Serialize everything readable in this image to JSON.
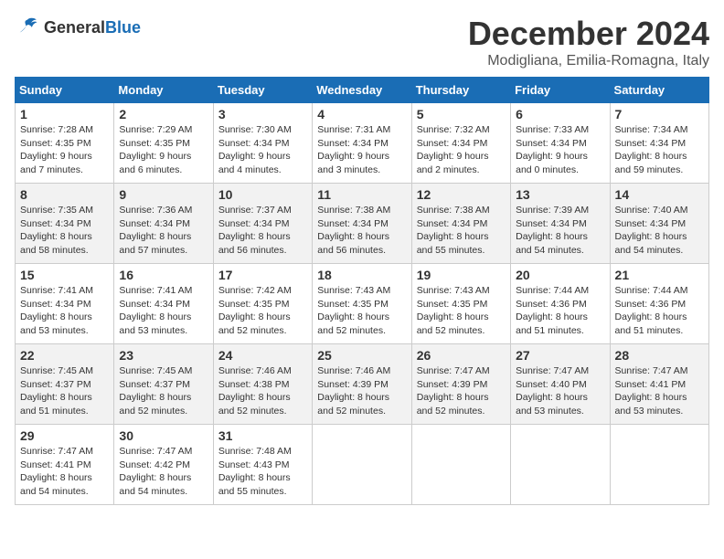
{
  "header": {
    "logo_general": "General",
    "logo_blue": "Blue",
    "title": "December 2024",
    "location": "Modigliana, Emilia-Romagna, Italy"
  },
  "days_of_week": [
    "Sunday",
    "Monday",
    "Tuesday",
    "Wednesday",
    "Thursday",
    "Friday",
    "Saturday"
  ],
  "weeks": [
    [
      {
        "day": "1",
        "sunrise": "Sunrise: 7:28 AM",
        "sunset": "Sunset: 4:35 PM",
        "daylight": "Daylight: 9 hours and 7 minutes."
      },
      {
        "day": "2",
        "sunrise": "Sunrise: 7:29 AM",
        "sunset": "Sunset: 4:35 PM",
        "daylight": "Daylight: 9 hours and 6 minutes."
      },
      {
        "day": "3",
        "sunrise": "Sunrise: 7:30 AM",
        "sunset": "Sunset: 4:34 PM",
        "daylight": "Daylight: 9 hours and 4 minutes."
      },
      {
        "day": "4",
        "sunrise": "Sunrise: 7:31 AM",
        "sunset": "Sunset: 4:34 PM",
        "daylight": "Daylight: 9 hours and 3 minutes."
      },
      {
        "day": "5",
        "sunrise": "Sunrise: 7:32 AM",
        "sunset": "Sunset: 4:34 PM",
        "daylight": "Daylight: 9 hours and 2 minutes."
      },
      {
        "day": "6",
        "sunrise": "Sunrise: 7:33 AM",
        "sunset": "Sunset: 4:34 PM",
        "daylight": "Daylight: 9 hours and 0 minutes."
      },
      {
        "day": "7",
        "sunrise": "Sunrise: 7:34 AM",
        "sunset": "Sunset: 4:34 PM",
        "daylight": "Daylight: 8 hours and 59 minutes."
      }
    ],
    [
      {
        "day": "8",
        "sunrise": "Sunrise: 7:35 AM",
        "sunset": "Sunset: 4:34 PM",
        "daylight": "Daylight: 8 hours and 58 minutes."
      },
      {
        "day": "9",
        "sunrise": "Sunrise: 7:36 AM",
        "sunset": "Sunset: 4:34 PM",
        "daylight": "Daylight: 8 hours and 57 minutes."
      },
      {
        "day": "10",
        "sunrise": "Sunrise: 7:37 AM",
        "sunset": "Sunset: 4:34 PM",
        "daylight": "Daylight: 8 hours and 56 minutes."
      },
      {
        "day": "11",
        "sunrise": "Sunrise: 7:38 AM",
        "sunset": "Sunset: 4:34 PM",
        "daylight": "Daylight: 8 hours and 56 minutes."
      },
      {
        "day": "12",
        "sunrise": "Sunrise: 7:38 AM",
        "sunset": "Sunset: 4:34 PM",
        "daylight": "Daylight: 8 hours and 55 minutes."
      },
      {
        "day": "13",
        "sunrise": "Sunrise: 7:39 AM",
        "sunset": "Sunset: 4:34 PM",
        "daylight": "Daylight: 8 hours and 54 minutes."
      },
      {
        "day": "14",
        "sunrise": "Sunrise: 7:40 AM",
        "sunset": "Sunset: 4:34 PM",
        "daylight": "Daylight: 8 hours and 54 minutes."
      }
    ],
    [
      {
        "day": "15",
        "sunrise": "Sunrise: 7:41 AM",
        "sunset": "Sunset: 4:34 PM",
        "daylight": "Daylight: 8 hours and 53 minutes."
      },
      {
        "day": "16",
        "sunrise": "Sunrise: 7:41 AM",
        "sunset": "Sunset: 4:34 PM",
        "daylight": "Daylight: 8 hours and 53 minutes."
      },
      {
        "day": "17",
        "sunrise": "Sunrise: 7:42 AM",
        "sunset": "Sunset: 4:35 PM",
        "daylight": "Daylight: 8 hours and 52 minutes."
      },
      {
        "day": "18",
        "sunrise": "Sunrise: 7:43 AM",
        "sunset": "Sunset: 4:35 PM",
        "daylight": "Daylight: 8 hours and 52 minutes."
      },
      {
        "day": "19",
        "sunrise": "Sunrise: 7:43 AM",
        "sunset": "Sunset: 4:35 PM",
        "daylight": "Daylight: 8 hours and 52 minutes."
      },
      {
        "day": "20",
        "sunrise": "Sunrise: 7:44 AM",
        "sunset": "Sunset: 4:36 PM",
        "daylight": "Daylight: 8 hours and 51 minutes."
      },
      {
        "day": "21",
        "sunrise": "Sunrise: 7:44 AM",
        "sunset": "Sunset: 4:36 PM",
        "daylight": "Daylight: 8 hours and 51 minutes."
      }
    ],
    [
      {
        "day": "22",
        "sunrise": "Sunrise: 7:45 AM",
        "sunset": "Sunset: 4:37 PM",
        "daylight": "Daylight: 8 hours and 51 minutes."
      },
      {
        "day": "23",
        "sunrise": "Sunrise: 7:45 AM",
        "sunset": "Sunset: 4:37 PM",
        "daylight": "Daylight: 8 hours and 52 minutes."
      },
      {
        "day": "24",
        "sunrise": "Sunrise: 7:46 AM",
        "sunset": "Sunset: 4:38 PM",
        "daylight": "Daylight: 8 hours and 52 minutes."
      },
      {
        "day": "25",
        "sunrise": "Sunrise: 7:46 AM",
        "sunset": "Sunset: 4:39 PM",
        "daylight": "Daylight: 8 hours and 52 minutes."
      },
      {
        "day": "26",
        "sunrise": "Sunrise: 7:47 AM",
        "sunset": "Sunset: 4:39 PM",
        "daylight": "Daylight: 8 hours and 52 minutes."
      },
      {
        "day": "27",
        "sunrise": "Sunrise: 7:47 AM",
        "sunset": "Sunset: 4:40 PM",
        "daylight": "Daylight: 8 hours and 53 minutes."
      },
      {
        "day": "28",
        "sunrise": "Sunrise: 7:47 AM",
        "sunset": "Sunset: 4:41 PM",
        "daylight": "Daylight: 8 hours and 53 minutes."
      }
    ],
    [
      {
        "day": "29",
        "sunrise": "Sunrise: 7:47 AM",
        "sunset": "Sunset: 4:41 PM",
        "daylight": "Daylight: 8 hours and 54 minutes."
      },
      {
        "day": "30",
        "sunrise": "Sunrise: 7:47 AM",
        "sunset": "Sunset: 4:42 PM",
        "daylight": "Daylight: 8 hours and 54 minutes."
      },
      {
        "day": "31",
        "sunrise": "Sunrise: 7:48 AM",
        "sunset": "Sunset: 4:43 PM",
        "daylight": "Daylight: 8 hours and 55 minutes."
      },
      null,
      null,
      null,
      null
    ]
  ]
}
